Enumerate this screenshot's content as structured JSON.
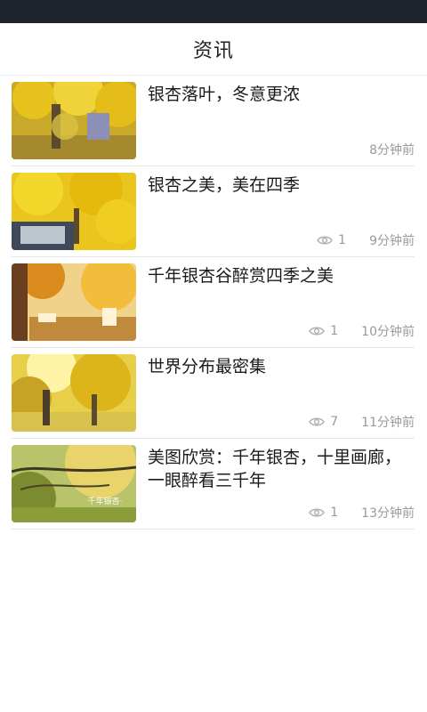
{
  "header": {
    "title": "资讯"
  },
  "icons": {
    "views": "eye-icon"
  },
  "colors": {
    "status_bar": "#1f232b",
    "meta_text": "#9a9a9a",
    "divider": "#e6e6e6"
  },
  "articles": [
    {
      "title": "银杏落叶，冬意更浓",
      "views": "",
      "time": "8分钟前"
    },
    {
      "title": "银杏之美，美在四季",
      "views": "1",
      "time": "9分钟前"
    },
    {
      "title": "千年银杏谷醉赏四季之美",
      "views": "1",
      "time": "10分钟前"
    },
    {
      "title": "世界分布最密集",
      "views": "7",
      "time": "11分钟前"
    },
    {
      "title": "美图欣赏：千年银杏，十里画廊，一眼醉看三千年",
      "views": "1",
      "time": "13分钟前",
      "thumb_caption": "千年银杏·"
    }
  ]
}
